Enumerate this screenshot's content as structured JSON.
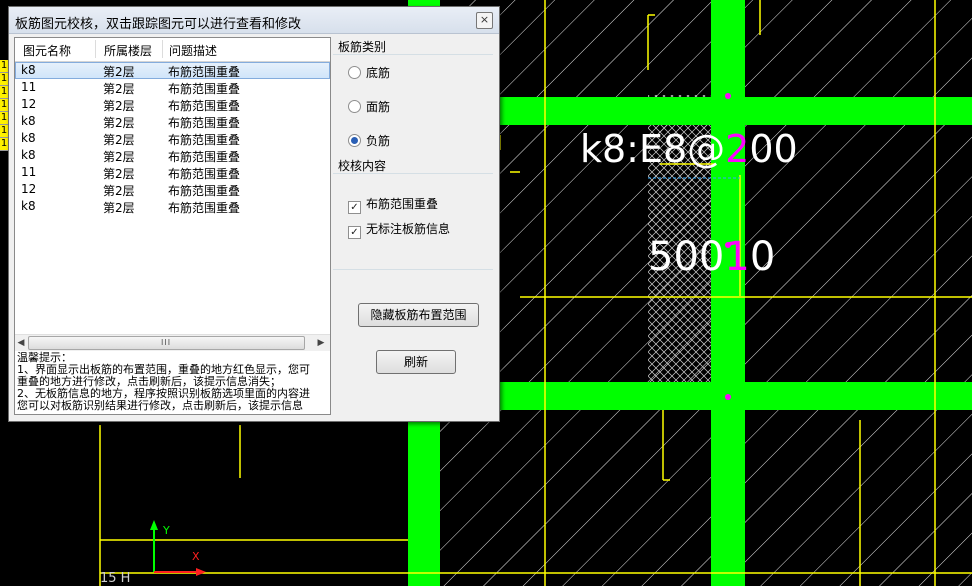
{
  "dialog": {
    "title": "板筋图元校核，双击跟踪图元可以进行查看和修改",
    "close_glyph": "×",
    "columns": [
      "图元名称",
      "所属楼层",
      "问题描述"
    ],
    "rows": [
      {
        "name": "k8",
        "floor": "第2层",
        "issue": "布筋范围重叠"
      },
      {
        "name": "11",
        "floor": "第2层",
        "issue": "布筋范围重叠"
      },
      {
        "name": "12",
        "floor": "第2层",
        "issue": "布筋范围重叠"
      },
      {
        "name": "k8",
        "floor": "第2层",
        "issue": "布筋范围重叠"
      },
      {
        "name": "k8",
        "floor": "第2层",
        "issue": "布筋范围重叠"
      },
      {
        "name": "k8",
        "floor": "第2层",
        "issue": "布筋范围重叠"
      },
      {
        "name": "11",
        "floor": "第2层",
        "issue": "布筋范围重叠"
      },
      {
        "name": "12",
        "floor": "第2层",
        "issue": "布筋范围重叠"
      },
      {
        "name": "k8",
        "floor": "第2层",
        "issue": "布筋范围重叠"
      }
    ],
    "scroll_grip": "III",
    "tips": [
      "温馨提示：",
      "1、界面显示出板筋的布置范围，重叠的地方红色显示，您可",
      "重叠的地方进行修改，点击刷新后，该提示信息消失；",
      "2、无板筋信息的地方，程序按照识别板筋选项里面的内容进",
      "您可以对板筋识别结果进行修改，点击刷新后，该提示信息"
    ],
    "rebar_type": {
      "label": "板筋类别",
      "options": [
        "底筋",
        "面筋",
        "负筋"
      ],
      "selected": "负筋"
    },
    "check_content": {
      "label": "校核内容",
      "options": [
        {
          "label": "布筋范围重叠",
          "checked": true
        },
        {
          "label": "无标注板筋信息",
          "checked": true
        }
      ]
    },
    "hide_button": "隐藏板筋布置范围",
    "refresh_button": "刷新"
  },
  "canvas": {
    "rebar_label_left": "k8:E8@",
    "rebar_label_mid": "2",
    "rebar_label_right": "00",
    "dim_label_left": "500",
    "dim_label_mid": "1",
    "dim_label_right": "0",
    "axis_y": "Y",
    "axis_x": "X",
    "corner_text": "15 H",
    "left_strip": [
      "1",
      "1",
      "1",
      "1",
      "1",
      "1",
      "1"
    ],
    "colors": {
      "background": "#000000",
      "beam": "#00ff00",
      "grid_line": "#ffff00",
      "hatch": "#ffffff",
      "highlight": "#ff00ff"
    }
  }
}
